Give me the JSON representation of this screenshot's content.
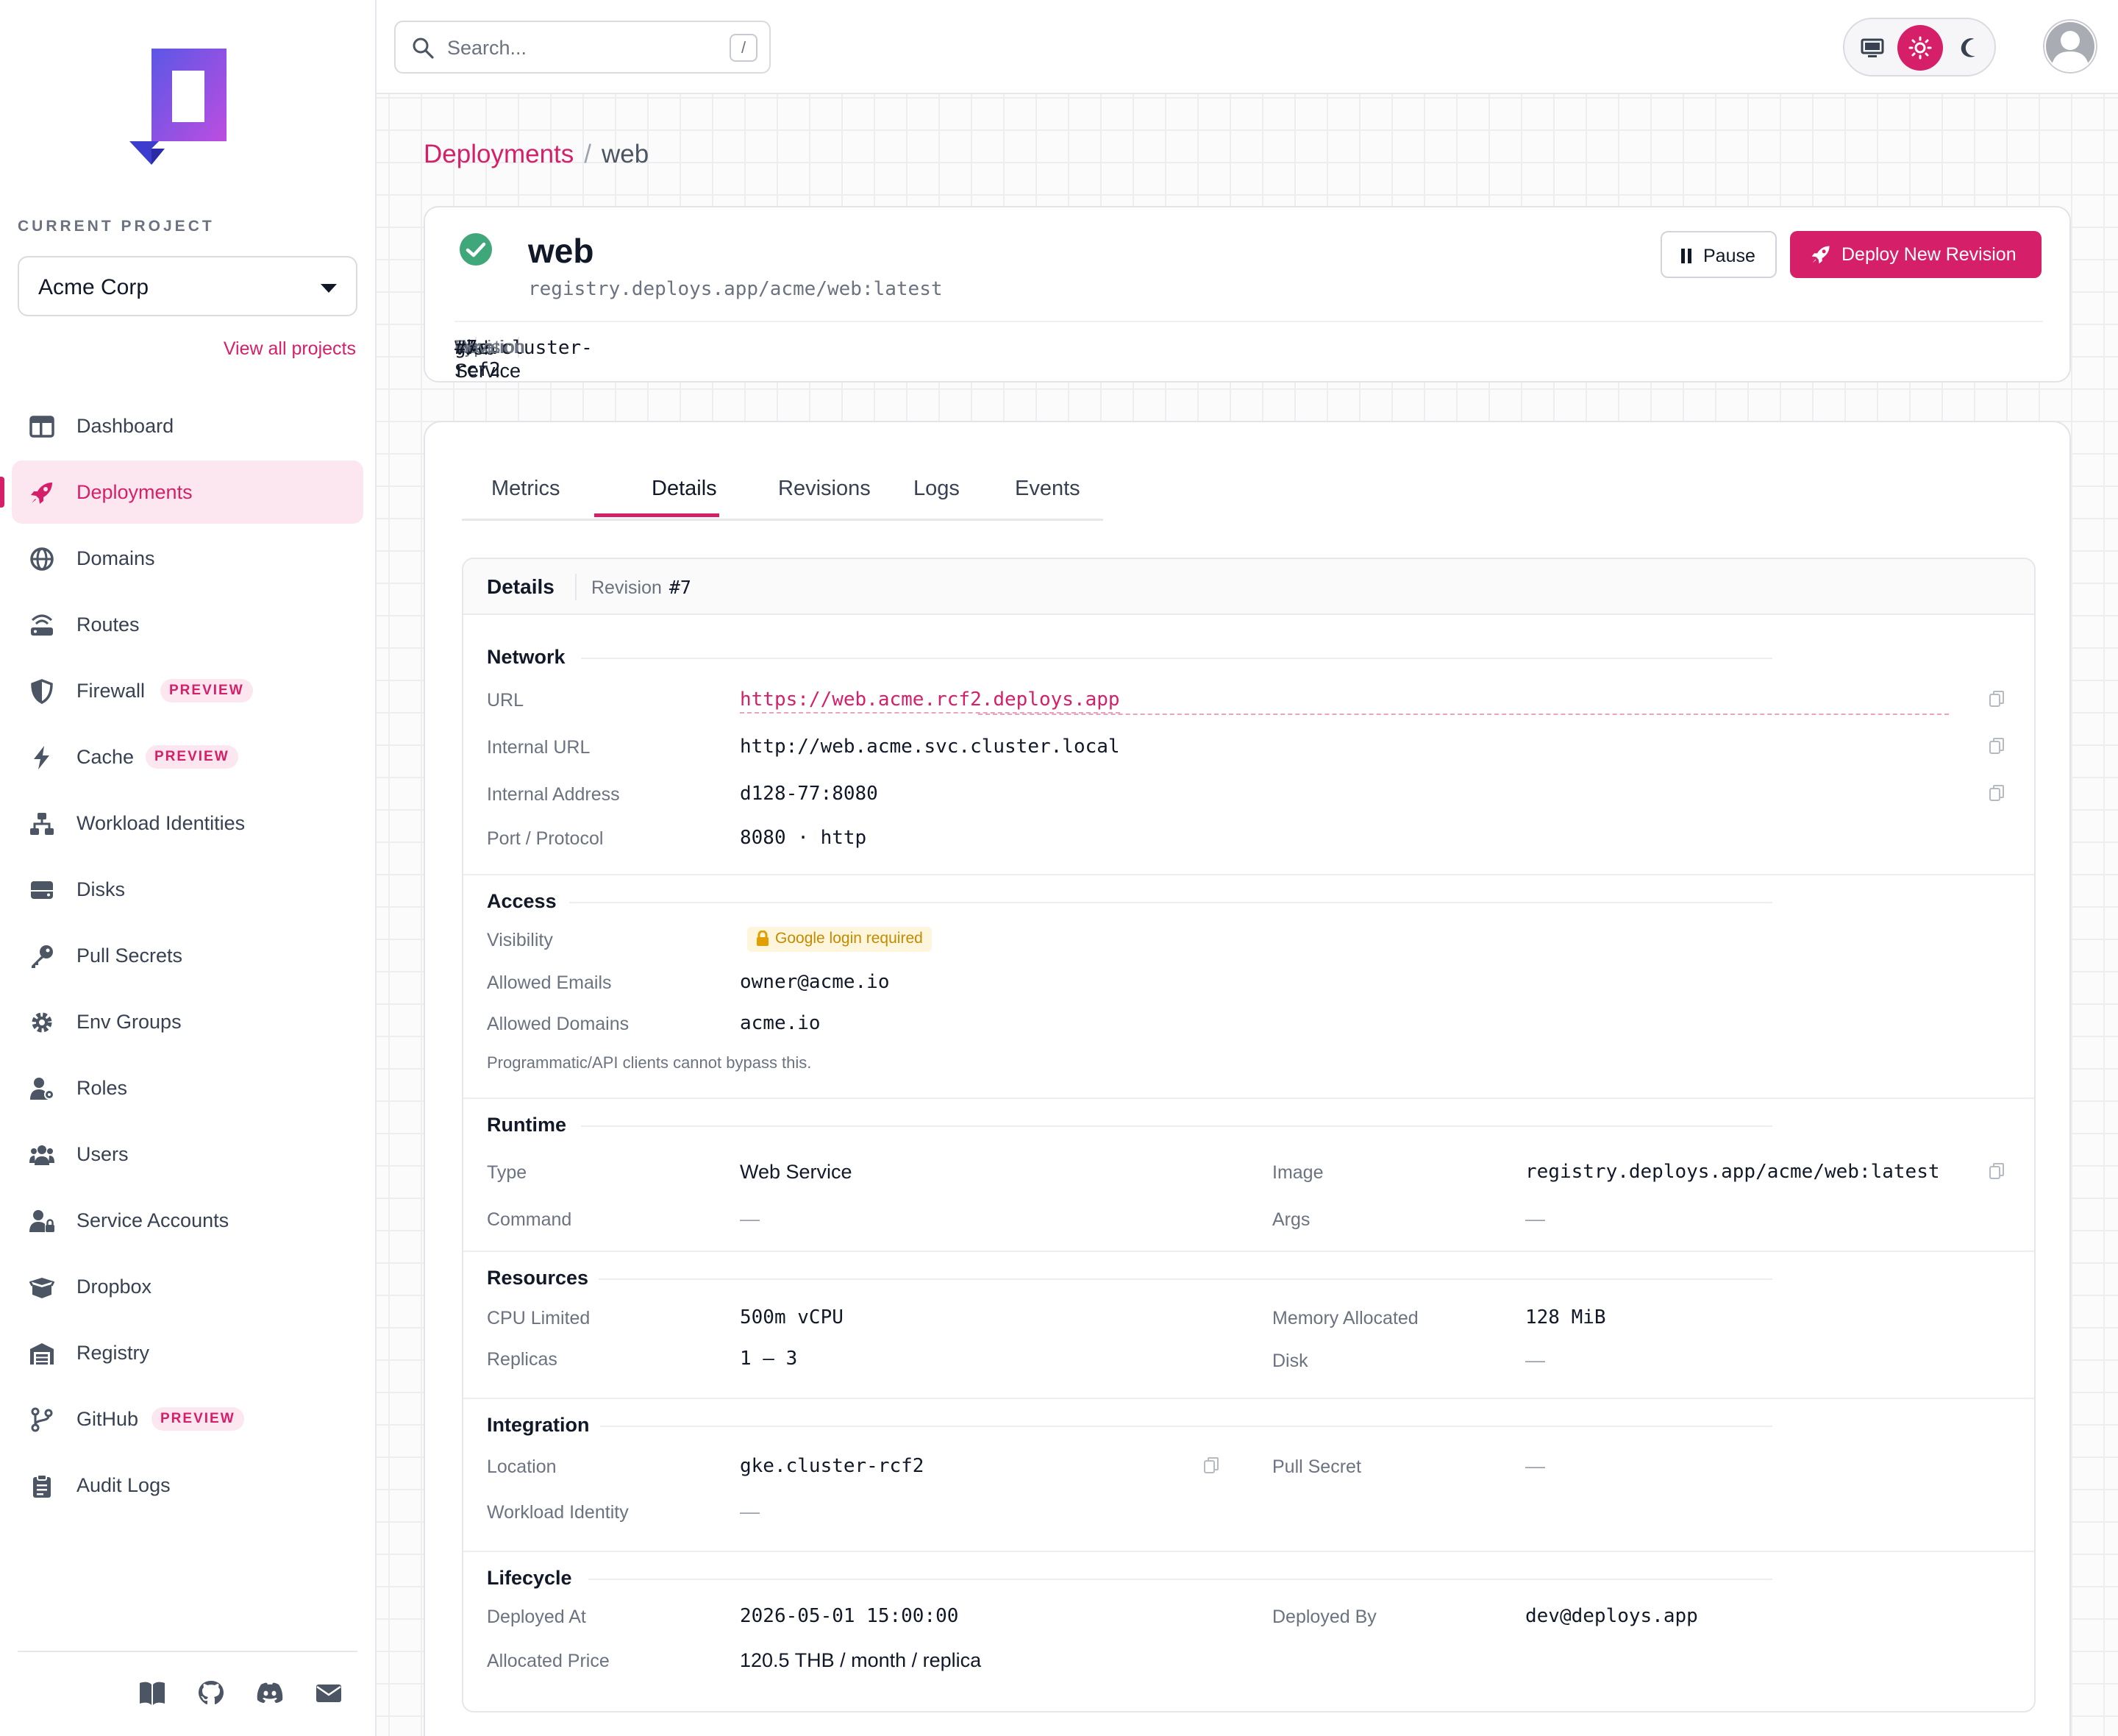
{
  "sidebar": {
    "project_label": "CURRENT PROJECT",
    "project_value": "Acme Corp",
    "view_all": "View all projects",
    "items": [
      {
        "label": "Dashboard",
        "icon": "dashboard-icon"
      },
      {
        "label": "Deployments",
        "icon": "rocket-icon",
        "active": true
      },
      {
        "label": "Domains",
        "icon": "globe-icon"
      },
      {
        "label": "Routes",
        "icon": "router-icon"
      },
      {
        "label": "Firewall",
        "icon": "shield-icon",
        "badge": "PREVIEW"
      },
      {
        "label": "Cache",
        "icon": "bolt-icon",
        "badge": "PREVIEW"
      },
      {
        "label": "Workload Identities",
        "icon": "network-icon"
      },
      {
        "label": "Disks",
        "icon": "disk-icon"
      },
      {
        "label": "Pull Secrets",
        "icon": "key-icon"
      },
      {
        "label": "Env Groups",
        "icon": "gear-icon"
      },
      {
        "label": "Roles",
        "icon": "user-gear-icon"
      },
      {
        "label": "Users",
        "icon": "users-icon"
      },
      {
        "label": "Service Accounts",
        "icon": "user-lock-icon"
      },
      {
        "label": "Dropbox",
        "icon": "box-icon"
      },
      {
        "label": "Registry",
        "icon": "warehouse-icon"
      },
      {
        "label": "GitHub",
        "icon": "branch-icon",
        "badge": "PREVIEW"
      },
      {
        "label": "Audit Logs",
        "icon": "clipboard-icon"
      }
    ]
  },
  "topbar": {
    "search_placeholder": "Search...",
    "search_shortcut": "/"
  },
  "breadcrumb": {
    "parent": "Deployments",
    "separator": "/",
    "current": "web"
  },
  "deployment": {
    "name": "web",
    "image": "registry.deploys.app/acme/web:latest",
    "pause_label": "Pause",
    "deploy_label": "Deploy New Revision",
    "meta": [
      {
        "key": "Type",
        "value": "Web Service"
      },
      {
        "key": "Location",
        "value": "gke.cluster-rcf2"
      },
      {
        "key": "Revision",
        "value": "#7"
      }
    ]
  },
  "tabs": [
    "Metrics",
    "Details",
    "Revisions",
    "Logs",
    "Events"
  ],
  "active_tab": "Details",
  "details": {
    "header_title": "Details",
    "revision_label": "Revision",
    "revision_value": "#7",
    "network": {
      "title": "Network",
      "url_k": "URL",
      "url_v": "https://web.acme.rcf2.deploys.app",
      "iurl_k": "Internal URL",
      "iurl_v": "http://web.acme.svc.cluster.local",
      "iaddr_k": "Internal Address",
      "iaddr_v": "d128-77:8080",
      "port_k": "Port / Protocol",
      "port_v": "8080 · http"
    },
    "access": {
      "title": "Access",
      "vis_k": "Visibility",
      "vis_v": "Google login required",
      "emails_k": "Allowed Emails",
      "emails_v": "owner@acme.io",
      "domains_k": "Allowed Domains",
      "domains_v": "acme.io",
      "note": "Programmatic/API clients cannot bypass this."
    },
    "runtime": {
      "title": "Runtime",
      "type_k": "Type",
      "type_v": "Web Service",
      "image_k": "Image",
      "image_v": "registry.deploys.app/acme/web:latest",
      "cmd_k": "Command",
      "cmd_v": "—",
      "args_k": "Args",
      "args_v": "—"
    },
    "resources": {
      "title": "Resources",
      "cpu_k": "CPU Limited",
      "cpu_v": "500m vCPU",
      "mem_k": "Memory Allocated",
      "mem_v": "128 MiB",
      "rep_k": "Replicas",
      "rep_v": "1 – 3",
      "disk_k": "Disk",
      "disk_v": "—"
    },
    "integration": {
      "title": "Integration",
      "loc_k": "Location",
      "loc_v": "gke.cluster-rcf2",
      "ps_k": "Pull Secret",
      "ps_v": "—",
      "wi_k": "Workload Identity",
      "wi_v": "—"
    },
    "lifecycle": {
      "title": "Lifecycle",
      "at_k": "Deployed At",
      "at_v": "2026-05-01 15:00:00",
      "by_k": "Deployed By",
      "by_v": "dev@deploys.app",
      "price_k": "Allocated Price",
      "price_v": "120.5 THB / month / replica"
    }
  },
  "colors": {
    "accent": "#d61f69",
    "success": "#3fa77a",
    "warning": "#c58a00"
  }
}
